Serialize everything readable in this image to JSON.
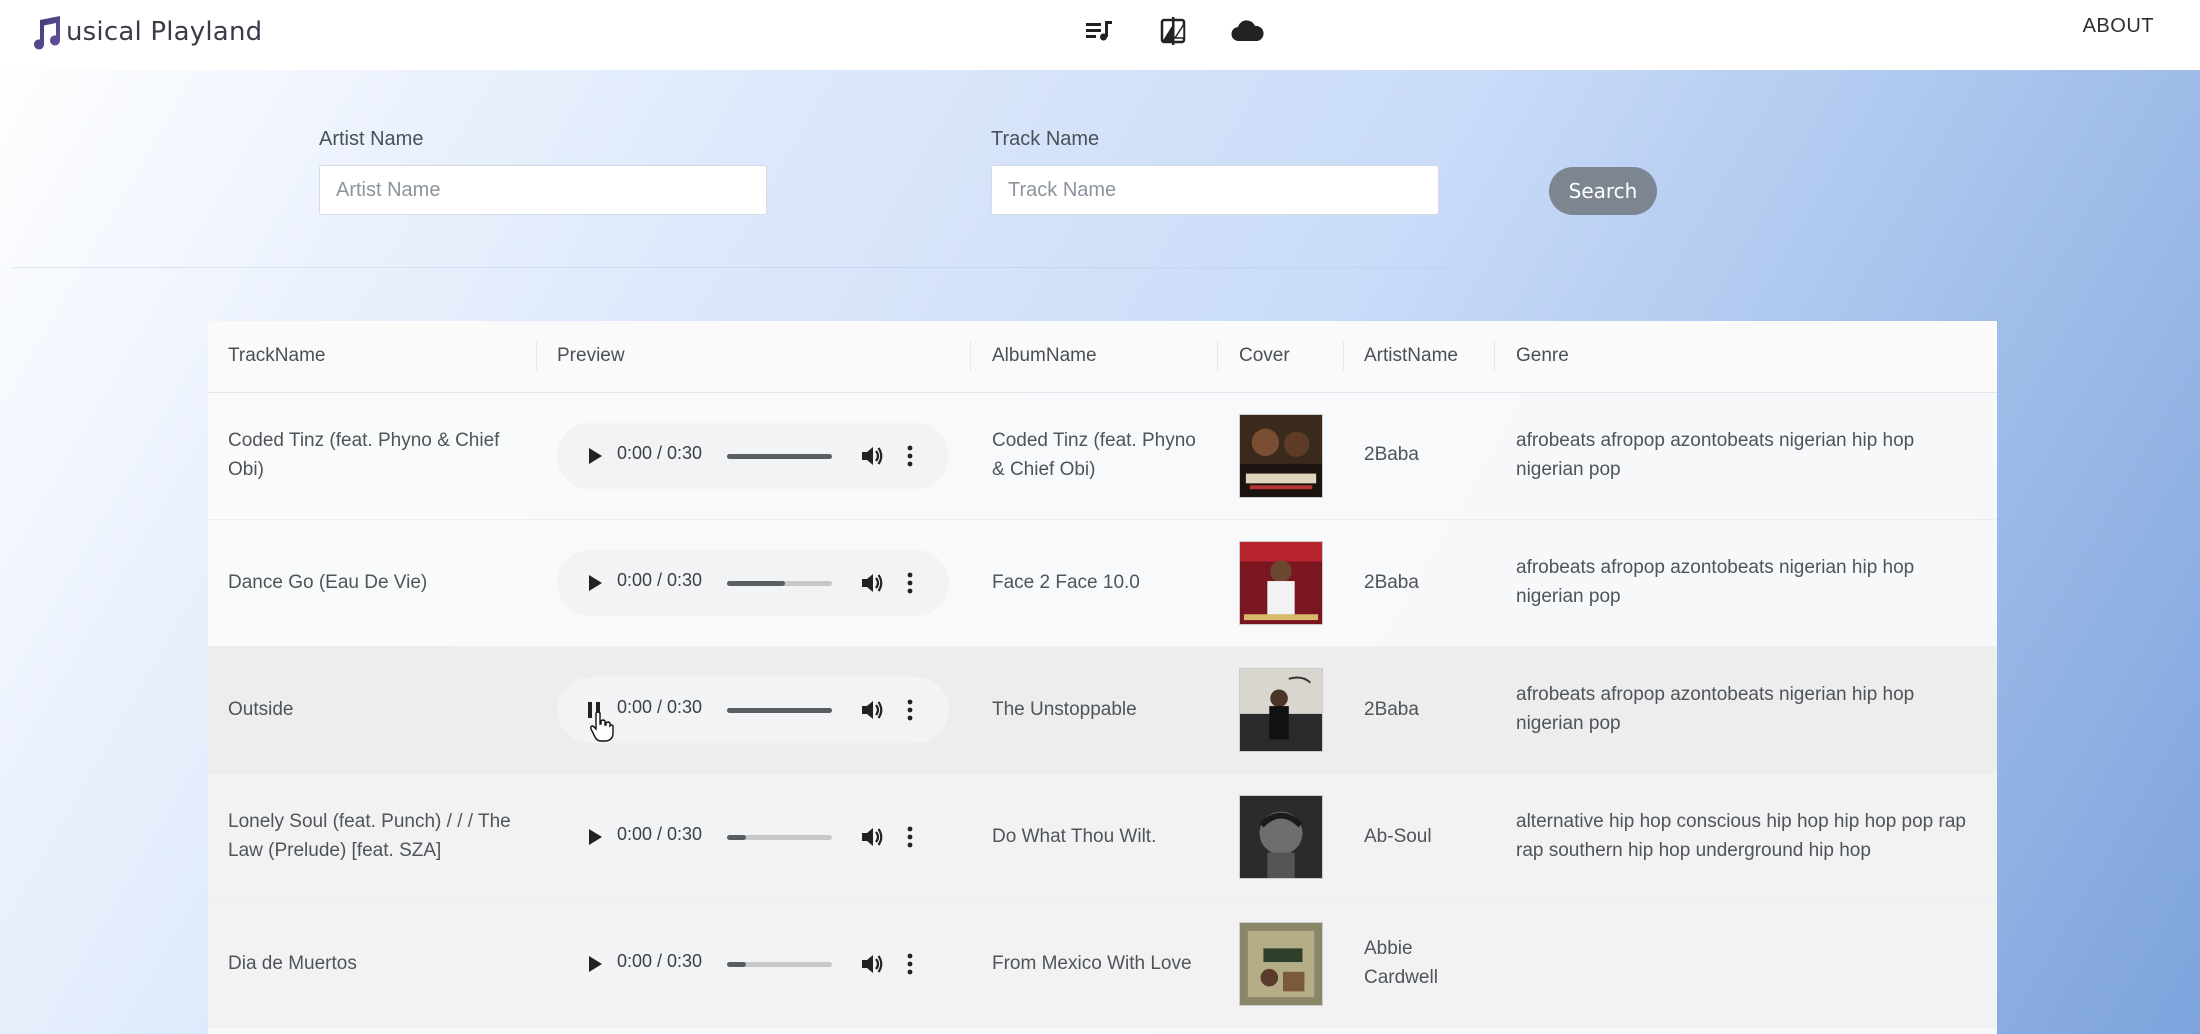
{
  "header": {
    "brand": "usical Playland",
    "icons": [
      "playlist-icon",
      "compare-icon",
      "cloud-icon"
    ],
    "about": "ABOUT"
  },
  "search": {
    "artist_label": "Artist Name",
    "artist_placeholder": "Artist Name",
    "track_label": "Track Name",
    "track_placeholder": "Track Name",
    "button": "Search"
  },
  "table": {
    "headers": [
      "TrackName",
      "Preview",
      "AlbumName",
      "Cover",
      "ArtistName",
      "Genre"
    ],
    "rows": [
      {
        "track": "Coded Tinz (feat. Phyno & Chief Obi)",
        "time": "0:00 / 0:30",
        "progress": 1.0,
        "playing": false,
        "album": "Coded Tinz (feat. Phyno & Chief Obi)",
        "artist": "2Baba",
        "genre": "afrobeats afropop azontobeats nigerian hip hop nigerian pop"
      },
      {
        "track": "Dance Go (Eau De Vie)",
        "time": "0:00 / 0:30",
        "progress": 0.55,
        "playing": false,
        "album": "Face 2 Face 10.0",
        "artist": "2Baba",
        "genre": "afrobeats afropop azontobeats nigerian hip hop nigerian pop"
      },
      {
        "track": "Outside",
        "time": "0:00 / 0:30",
        "progress": 1.0,
        "playing": true,
        "album": "The Unstoppable",
        "artist": "2Baba",
        "genre": "afrobeats afropop azontobeats nigerian hip hop nigerian pop"
      },
      {
        "track": "Lonely Soul (feat. Punch) / / / The Law (Prelude) [feat. SZA]",
        "time": "0:00 / 0:30",
        "progress": 0.18,
        "playing": false,
        "album": "Do What Thou Wilt.",
        "artist": "Ab-Soul",
        "genre": "alternative hip hop conscious hip hop hip hop pop rap rap southern hip hop underground hip hop"
      },
      {
        "track": "Dia de Muertos",
        "time": "0:00 / 0:30",
        "progress": 0.18,
        "playing": false,
        "album": "From Mexico With Love",
        "artist": "Abbie Cardwell",
        "genre": ""
      }
    ]
  },
  "colors": {
    "accent": "#7c8590",
    "nav_bg": "#ffffff",
    "player_bg": "#f1f3f4"
  }
}
